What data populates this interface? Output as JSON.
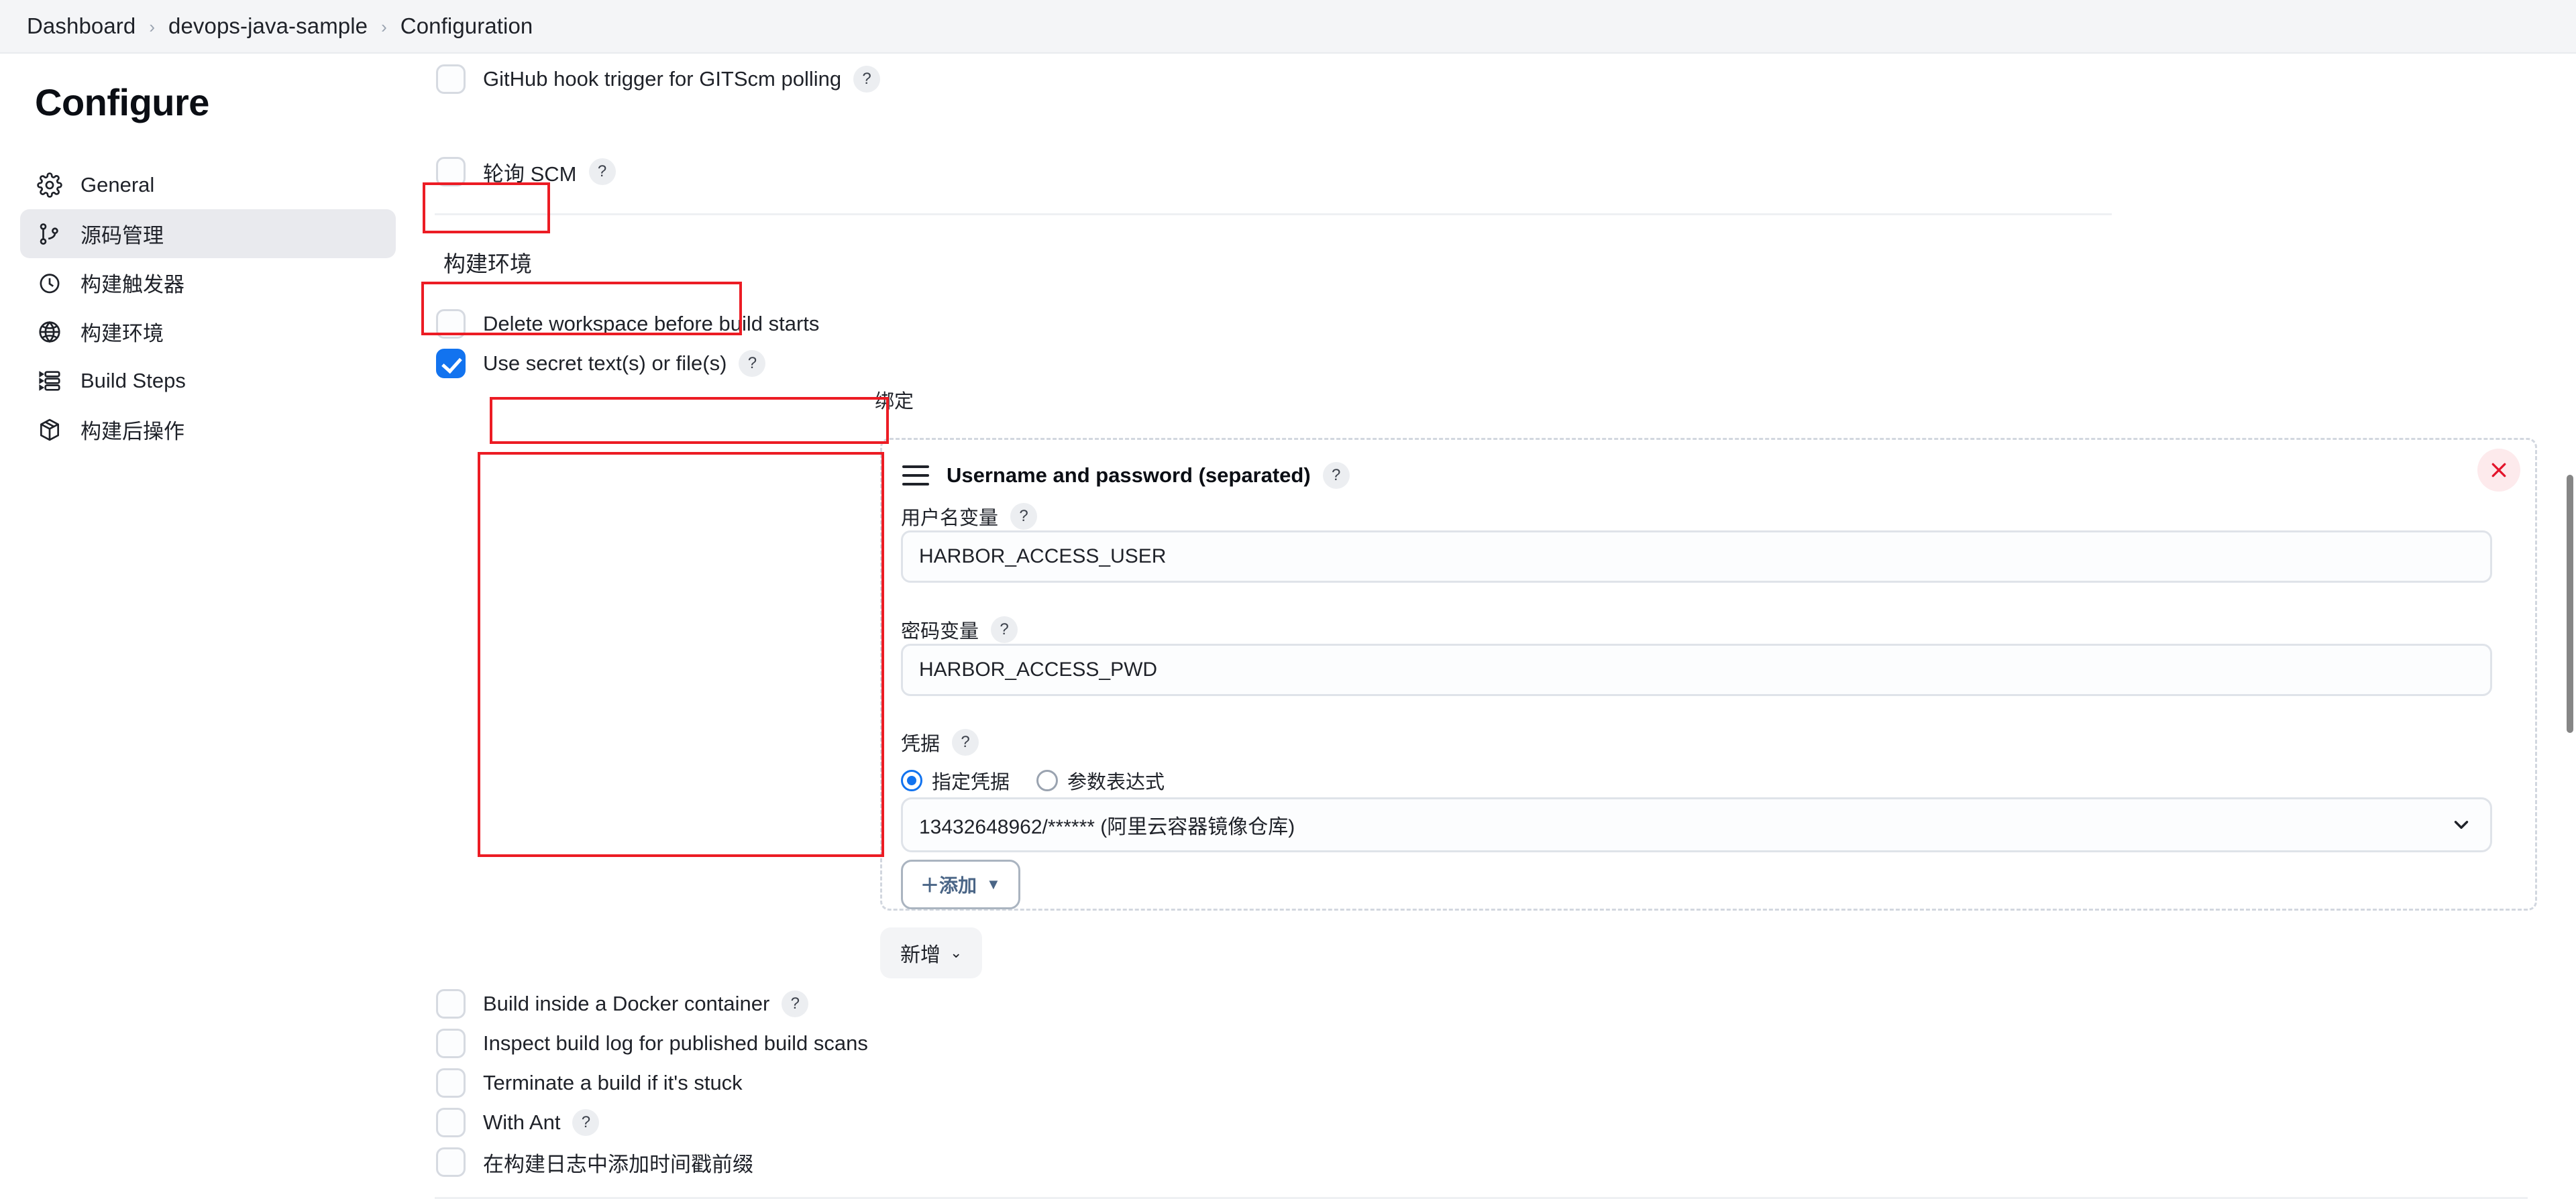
{
  "breadcrumb": {
    "items": [
      "Dashboard",
      "devops-java-sample",
      "Configuration"
    ],
    "separator": "›"
  },
  "sidebar": {
    "title": "Configure",
    "items": [
      {
        "label": "General",
        "icon": "gear-icon",
        "active": false
      },
      {
        "label": "源码管理",
        "icon": "git-branch-icon",
        "active": true
      },
      {
        "label": "构建触发器",
        "icon": "clock-icon",
        "active": false
      },
      {
        "label": "构建环境",
        "icon": "globe-icon",
        "active": false
      },
      {
        "label": "Build Steps",
        "icon": "list-steps-icon",
        "active": false
      },
      {
        "label": "构建后操作",
        "icon": "package-icon",
        "active": false
      }
    ]
  },
  "main": {
    "trigger_checkboxes": [
      {
        "label": "GitHub hook trigger for GITScm polling",
        "checked": false,
        "help": "?"
      },
      {
        "label": "轮询 SCM",
        "checked": false,
        "help": "?"
      }
    ],
    "build_env": {
      "section_title": "构建环境",
      "delete_workspace": {
        "label": "Delete workspace before build starts",
        "checked": false
      },
      "use_secret": {
        "label": "Use secret text(s) or file(s)",
        "checked": true,
        "help": "?"
      },
      "bindings_label": "绑定",
      "binding_card": {
        "title": "Username and password (separated)",
        "help": "?",
        "drag_handle": "drag-handle-icon",
        "close": "close-icon",
        "username_variable": {
          "label": "用户名变量",
          "help": "?",
          "value": "HARBOR_ACCESS_USER"
        },
        "password_variable": {
          "label": "密码变量",
          "help": "?",
          "value": "HARBOR_ACCESS_PWD"
        },
        "credentials": {
          "label": "凭据",
          "help": "?",
          "radios": [
            {
              "label": "指定凭据",
              "selected": true
            },
            {
              "label": "参数表达式",
              "selected": false
            }
          ],
          "selected_value": "13432648962/****** (阿里云容器镜像仓库)",
          "add_button": "＋添加"
        }
      },
      "add_binding_button": "新增"
    },
    "env_checkboxes": [
      {
        "label": "Build inside a Docker container",
        "checked": false,
        "help": "?"
      },
      {
        "label": "Inspect build log for published build scans",
        "checked": false,
        "help": ""
      },
      {
        "label": "Terminate a build if it's stuck",
        "checked": false,
        "help": ""
      },
      {
        "label": "With Ant",
        "checked": false,
        "help": "?"
      },
      {
        "label": "在构建日志中添加时间戳前缀",
        "checked": false,
        "help": ""
      }
    ]
  },
  "colors": {
    "accent_blue": "#1273ef",
    "annotation_red": "#ec1c24",
    "close_red": "#e3142b",
    "topbar_bg": "#f4f5f7",
    "active_nav_bg": "#e9eaee"
  }
}
